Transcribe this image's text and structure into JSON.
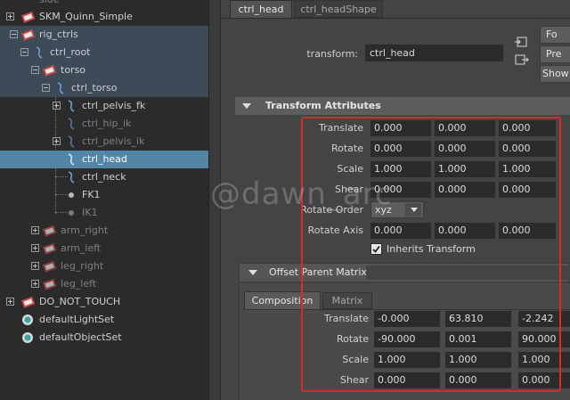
{
  "outliner": {
    "items": [
      {
        "label": "side",
        "dim": true
      },
      {
        "label": "SKM_Quinn_Simple"
      },
      {
        "label": "rig_ctrls"
      },
      {
        "label": "ctrl_root"
      },
      {
        "label": "torso"
      },
      {
        "label": "ctrl_torso"
      },
      {
        "label": "ctrl_pelvis_fk"
      },
      {
        "label": "ctrl_hip_ik",
        "dim": true
      },
      {
        "label": "ctrl_pelvis_ik",
        "dim": true
      },
      {
        "label": "ctrl_head",
        "selected": true
      },
      {
        "label": "ctrl_neck"
      },
      {
        "label": "FK1"
      },
      {
        "label": "IK1",
        "dim": true
      },
      {
        "label": "arm_right",
        "dim": true
      },
      {
        "label": "arm_left",
        "dim": true
      },
      {
        "label": "leg_right",
        "dim": true
      },
      {
        "label": "leg_left",
        "dim": true
      },
      {
        "label": "DO_NOT_TOUCH"
      },
      {
        "label": "defaultLightSet"
      },
      {
        "label": "defaultObjectSet"
      }
    ]
  },
  "tabs": [
    {
      "label": "ctrl_head",
      "active": true
    },
    {
      "label": "ctrl_headShape",
      "active": false
    }
  ],
  "node": {
    "type_label": "transform:",
    "name": "ctrl_head",
    "buttons": [
      "Fo",
      "Pre",
      "Show"
    ]
  },
  "transform_attributes": {
    "title": "Transform Attributes",
    "rows": [
      {
        "label": "Translate",
        "values": [
          "0.000",
          "0.000",
          "0.000"
        ]
      },
      {
        "label": "Rotate",
        "values": [
          "0.000",
          "0.000",
          "0.000"
        ]
      },
      {
        "label": "Scale",
        "values": [
          "1.000",
          "1.000",
          "1.000"
        ]
      },
      {
        "label": "Shear",
        "values": [
          "0.000",
          "0.000",
          "0.000"
        ]
      }
    ],
    "rotate_order_label": "Rotate Order",
    "rotate_order_value": "xyz",
    "rotate_axis_label": "Rotate Axis",
    "rotate_axis_values": [
      "0.000",
      "0.000",
      "0.000"
    ],
    "inherits_transform_label": "Inherits Transform",
    "inherits_transform_checked": true
  },
  "offset_parent_matrix": {
    "title": "Offset Parent Matrix",
    "tabs": [
      "Composition",
      "Matrix"
    ],
    "active_tab": "Composition",
    "rows": [
      {
        "label": "Translate",
        "values": [
          "-0.000",
          "63.810",
          "-2.242"
        ]
      },
      {
        "label": "Rotate",
        "values": [
          "-90.000",
          "0.001",
          "90.000"
        ]
      },
      {
        "label": "Scale",
        "values": [
          "1.000",
          "1.000",
          "1.000"
        ]
      },
      {
        "label": "Shear",
        "values": [
          "0.000",
          "0.000",
          "0.000"
        ]
      }
    ]
  },
  "watermark": "@dawn_arc",
  "colors": {
    "highlight_box": "#e0282a",
    "selection": "#5285a6"
  }
}
